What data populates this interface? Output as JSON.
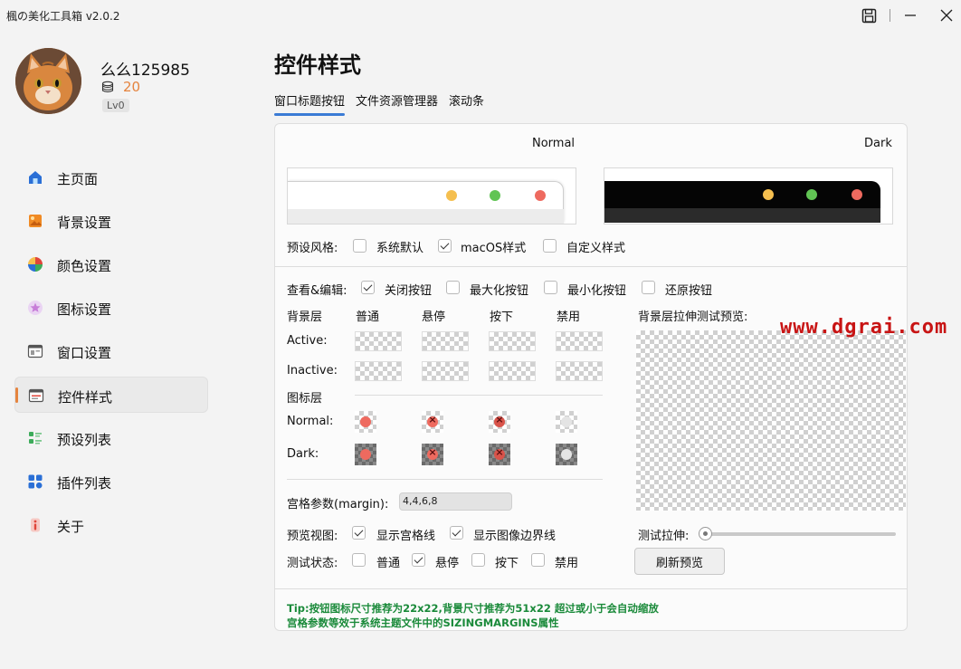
{
  "window": {
    "title": "楓の美化工具箱 v2.0.2",
    "save_icon": "save-icon",
    "min_icon": "minimize-icon",
    "close_icon": "close-icon"
  },
  "user": {
    "name": "么么125985",
    "coins": "20",
    "level": "Lv0"
  },
  "sidebar": {
    "items": [
      {
        "label": "主页面",
        "icon": "home-icon",
        "color": "#2a6fd6"
      },
      {
        "label": "背景设置",
        "icon": "image-icon",
        "color": "#f08a24"
      },
      {
        "label": "颜色设置",
        "icon": "palette-icon",
        "color": "#e0453a"
      },
      {
        "label": "图标设置",
        "icon": "star-icon",
        "color": "#c77dd8"
      },
      {
        "label": "窗口设置",
        "icon": "window-icon",
        "color": "#555555"
      },
      {
        "label": "控件样式",
        "icon": "widget-icon",
        "color": "#555555"
      },
      {
        "label": "预设列表",
        "icon": "list-icon",
        "color": "#3cab5a"
      },
      {
        "label": "插件列表",
        "icon": "plugin-icon",
        "color": "#2a6fd6"
      },
      {
        "label": "关于",
        "icon": "info-icon",
        "color": "#e0453a"
      }
    ],
    "active_index": 5
  },
  "main": {
    "title": "控件样式",
    "tabs": [
      "窗口标题按钮",
      "文件资源管理器",
      "滚动条"
    ],
    "active_tab": 0
  },
  "preview": {
    "normal_label": "Normal",
    "dark_label": "Dark"
  },
  "preset": {
    "label": "预设风格:",
    "options": [
      {
        "label": "系统默认",
        "checked": false
      },
      {
        "label": "macOS样式",
        "checked": true
      },
      {
        "label": "自定义样式",
        "checked": false
      }
    ]
  },
  "edit": {
    "label": "查看&编辑:",
    "options": [
      {
        "label": "关闭按钮",
        "checked": true
      },
      {
        "label": "最大化按钮",
        "checked": false
      },
      {
        "label": "最小化按钮",
        "checked": false
      },
      {
        "label": "还原按钮",
        "checked": false
      }
    ]
  },
  "grid": {
    "bg_layer": "背景层",
    "states": [
      "普通",
      "悬停",
      "按下",
      "禁用"
    ],
    "rows_bg": [
      "Active:",
      "Inactive:"
    ],
    "icon_layer": "图标层",
    "rows_icon": [
      "Normal:",
      "Dark:"
    ]
  },
  "stretch_preview_label": "背景层拉伸测试预览:",
  "margin": {
    "label": "宫格参数(margin):",
    "value": "4,4,6,8"
  },
  "view": {
    "label": "预览视图:",
    "options": [
      {
        "label": "显示宫格线",
        "checked": true
      },
      {
        "label": "显示图像边界线",
        "checked": true
      }
    ]
  },
  "test_state": {
    "label": "测试状态:",
    "options": [
      {
        "label": "普通",
        "checked": false
      },
      {
        "label": "悬停",
        "checked": true
      },
      {
        "label": "按下",
        "checked": false
      },
      {
        "label": "禁用",
        "checked": false
      }
    ]
  },
  "stretch": {
    "label": "测试拉伸:",
    "value": 0
  },
  "refresh_label": "刷新预览",
  "tip": {
    "line1": "Tip:按钮图标尺寸推荐为22x22,背景尺寸推荐为51x22 超过或小于会自动缩放",
    "line2": "宫格参数等效于系统主题文件中的SIZINGMARGINS属性"
  },
  "watermark": "www.dgrai.com",
  "colors": {
    "accent": "#e5843f",
    "tab_underline": "#3a7bd5",
    "tip": "#1a8a3a",
    "watermark": "#c81414",
    "mac_red": "#ee6a5f",
    "mac_yellow": "#f5bf4f",
    "mac_green": "#61c454"
  }
}
